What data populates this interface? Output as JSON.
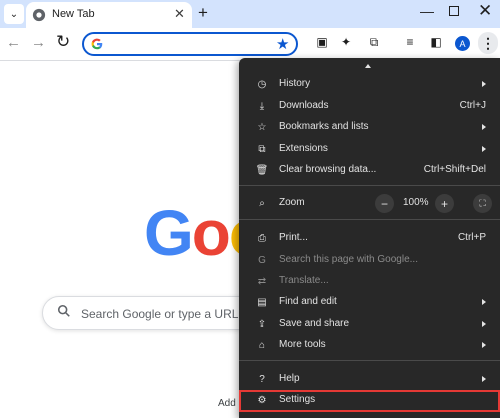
{
  "tabs": [
    {
      "title": "New Tab"
    }
  ],
  "toolbar": {
    "omnibox_placeholder": ""
  },
  "page": {
    "logo": {
      "g": "G",
      "o1": "o",
      "o2": "o"
    },
    "search_placeholder": "Search Google or type a URL",
    "add_shortcut_label": "Add s"
  },
  "menu": {
    "history": "History",
    "downloads": {
      "label": "Downloads",
      "shortcut": "Ctrl+J"
    },
    "bookmarks": "Bookmarks and lists",
    "extensions": "Extensions",
    "clear_data": {
      "label": "Clear browsing data...",
      "shortcut": "Ctrl+Shift+Del"
    },
    "zoom": {
      "label": "Zoom",
      "value": "100%",
      "minus": "−",
      "plus": "+"
    },
    "print": {
      "label": "Print...",
      "shortcut": "Ctrl+P"
    },
    "search_page": "Search this page with Google...",
    "translate": "Translate...",
    "find_edit": "Find and edit",
    "save_share": "Save and share",
    "more_tools": "More tools",
    "help": "Help",
    "settings": "Settings"
  },
  "profile": {
    "initial": "A"
  },
  "colors": {
    "accent": "#0b57d0",
    "tabstrip": "#d3e3fd",
    "menu_bg": "#282828",
    "highlight_border": "#e53935"
  }
}
